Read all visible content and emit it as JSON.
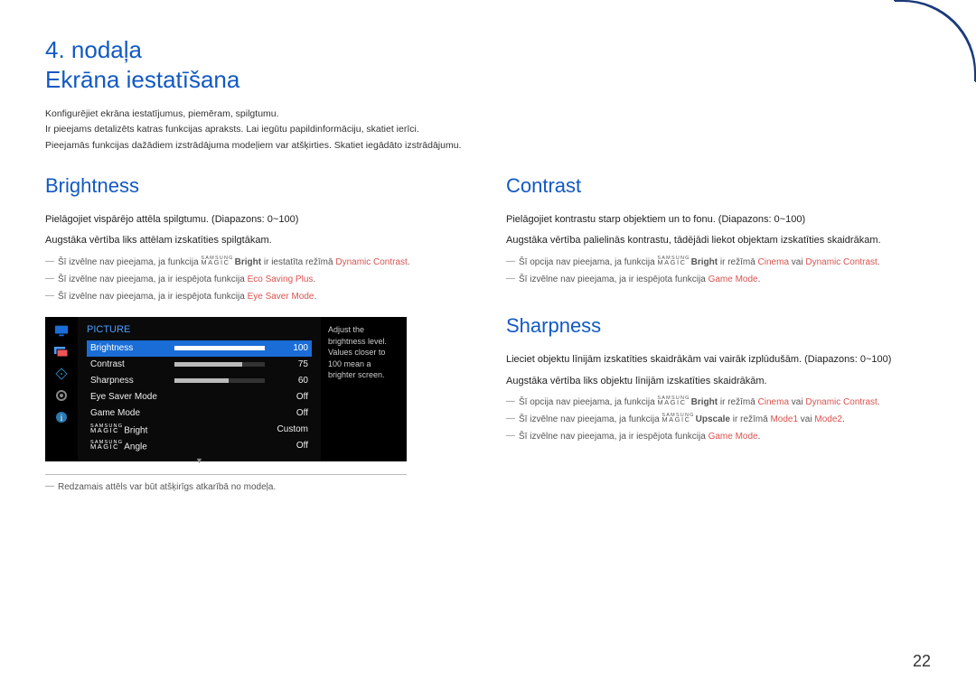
{
  "chapter": {
    "num": "4. nodaļa",
    "title": "Ekrāna iestatīšana"
  },
  "intro": {
    "l1": "Konfigurējiet ekrāna iestatījumus, piemēram, spilgtumu.",
    "l2": "Ir pieejams detalizēts katras funkcijas apraksts. Lai iegūtu papildinformāciju, skatiet ierīci.",
    "l3": "Pieejamās funkcijas dažādiem izstrādājuma modeļiem var atšķirties. Skatiet iegādāto izstrādājumu."
  },
  "brightness": {
    "heading": "Brightness",
    "p1": "Pielāgojiet vispārējo attēla spilgtumu. (Diapazons: 0~100)",
    "p2": "Augstāka vērtība liks attēlam izskatīties spilgtākam.",
    "n1a": "Šī izvēlne nav pieejama, ja funkcija ",
    "n1b": "Bright",
    "n1c": " ir iestatīta režīmā ",
    "n1d": "Dynamic Contrast",
    "n2a": "Šī izvēlne nav pieejama, ja ir iespējota funkcija ",
    "n2b": "Eco Saving Plus",
    "n3a": "Šī izvēlne nav pieejama, ja ir iespējota funkcija ",
    "n3b": "Eye Saver Mode"
  },
  "contrast": {
    "heading": "Contrast",
    "p1": "Pielāgojiet kontrastu starp objektiem un to fonu. (Diapazons: 0~100)",
    "p2": "Augstāka vērtība palielinās kontrastu, tādējādi liekot objektam izskatīties skaidrākam.",
    "n1a": "Šī opcija nav pieejama, ja funkcija ",
    "n1b": "Bright",
    "n1c": " ir režīmā ",
    "n1d": "Cinema",
    "n1e": " vai ",
    "n1f": "Dynamic Contrast",
    "n2a": "Šī izvēlne nav pieejama, ja ir iespējota funkcija ",
    "n2b": "Game Mode"
  },
  "sharpness": {
    "heading": "Sharpness",
    "p1": "Lieciet objektu līnijām izskatīties skaidrākām vai vairāk izplūdušām. (Diapazons: 0~100)",
    "p2": "Augstāka vērtība liks objektu līnijām izskatīties skaidrākām.",
    "n1a": "Šī opcija nav pieejama, ja funkcija ",
    "n1b": "Bright",
    "n1c": " ir režīmā ",
    "n1d": "Cinema",
    "n1e": " vai ",
    "n1f": "Dynamic Contrast",
    "n2a": "Šī izvēlne nav pieejama, ja funkcija ",
    "n2b": "Upscale",
    "n2c": " ir režīmā ",
    "n2d": "Mode1",
    "n2e": " vai ",
    "n2f": "Mode2",
    "n3a": "Šī izvēlne nav pieejama, ja ir iespējota funkcija ",
    "n3b": "Game Mode"
  },
  "osd": {
    "title": "PICTURE",
    "rows": {
      "brightness": {
        "label": "Brightness",
        "val": "100"
      },
      "contrast": {
        "label": "Contrast",
        "val": "75"
      },
      "sharpness": {
        "label": "Sharpness",
        "val": "60"
      },
      "eyesaver": {
        "label": "Eye Saver Mode",
        "val": "Off"
      },
      "gamemode": {
        "label": "Game Mode",
        "val": "Off"
      },
      "magicbright": {
        "label": "Bright",
        "val": "Custom"
      },
      "magicangle": {
        "label": "Angle",
        "val": "Off"
      }
    },
    "tip": "Adjust the brightness level. Values closer to 100 mean a brighter screen."
  },
  "magic": {
    "s": "SAMSUNG",
    "m": "MAGIC"
  },
  "footnote": "Redzamais attēls var būt atšķirīgs atkarībā no modeļa.",
  "pagenum": "22"
}
